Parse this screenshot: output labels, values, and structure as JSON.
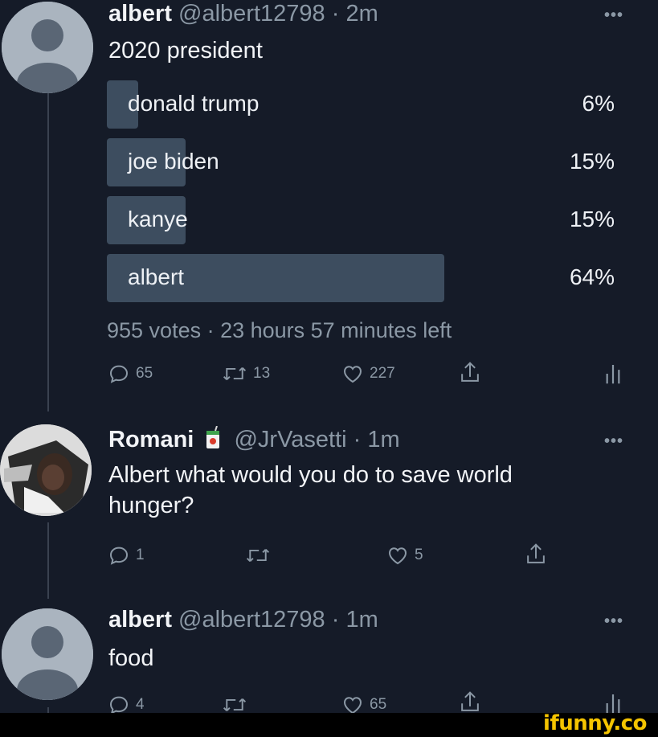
{
  "tweets": [
    {
      "name": "albert",
      "handle": "@albert12798",
      "sep": " · ",
      "time": "2m",
      "text": "2020 president",
      "more": "•••",
      "poll": {
        "options": [
          {
            "label": "donald trump",
            "percent_text": "6%",
            "percent": 6
          },
          {
            "label": "joe biden",
            "percent_text": "15%",
            "percent": 15
          },
          {
            "label": "kanye",
            "percent_text": "15%",
            "percent": 15
          },
          {
            "label": "albert",
            "percent_text": "64%",
            "percent": 64
          }
        ],
        "meta": "955 votes · 23 hours 57 minutes left"
      },
      "actions": {
        "replies": "65",
        "retweets": "13",
        "likes": "227"
      }
    },
    {
      "name": "Romani",
      "handle": "@JrVasetti",
      "sep": " · ",
      "time": "1m",
      "text": "Albert what would you do to save world\nhunger?",
      "more": "•••",
      "actions": {
        "replies": "1",
        "retweets": "",
        "likes": "5"
      }
    },
    {
      "name": "albert",
      "handle": "@albert12798",
      "sep": " · ",
      "time": "1m",
      "text": "food",
      "more": "•••",
      "actions": {
        "replies": "4",
        "retweets": "",
        "likes": "65"
      }
    }
  ],
  "watermark": "ifunny.co",
  "icons": [
    "reply-icon",
    "retweet-icon",
    "like-icon",
    "share-icon",
    "analytics-icon",
    "juice-box-icon"
  ],
  "colors": {
    "background": "#151b28",
    "poll_fill": "#3d4d5f",
    "muted": "#8b98a5",
    "watermark": "#f5c400"
  }
}
